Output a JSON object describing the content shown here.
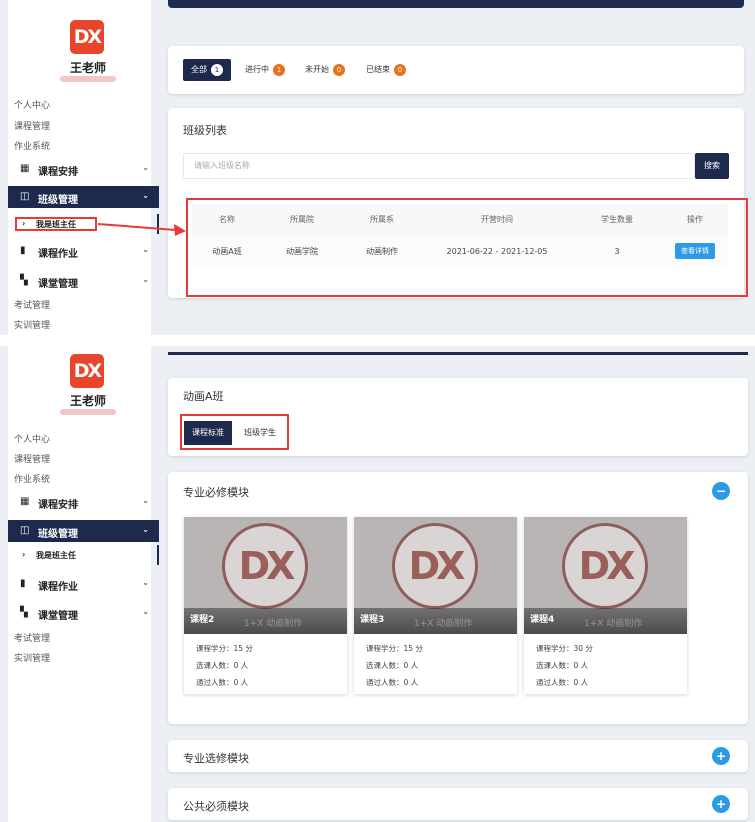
{
  "teacher_name": "王老师",
  "logo_text": "DX",
  "sidebar": {
    "plain_top": [
      "个人中心",
      "课程管理",
      "作业系统"
    ],
    "menus": [
      {
        "label": "课程安排",
        "icon": "calendar-icon",
        "glyph": "▦"
      },
      {
        "label": "班级管理",
        "icon": "class-icon",
        "glyph": "◫"
      },
      {
        "label": "课程作业",
        "icon": "homework-icon",
        "glyph": "▮"
      },
      {
        "label": "课堂管理",
        "icon": "book-icon",
        "glyph": "▚"
      }
    ],
    "submenu": "我是班主任",
    "plain_bottom": [
      "考试管理",
      "实训管理"
    ],
    "chevron": "⌄",
    "arrow": "›"
  },
  "filter_tabs": [
    {
      "label": "全部",
      "count": "1"
    },
    {
      "label": "进行中",
      "count": "1"
    },
    {
      "label": "未开始",
      "count": "0"
    },
    {
      "label": "已结束",
      "count": "0"
    }
  ],
  "class_list": {
    "title": "班级列表",
    "search_placeholder": "请输入班级名称",
    "search_button": "搜索",
    "columns": [
      "名称",
      "所属院",
      "所属系",
      "开营时间",
      "学生数量",
      "操作"
    ],
    "rows": [
      {
        "name": "动画A班",
        "college": "动画学院",
        "department": "动画制作",
        "period": "2021-06-22 - 2021-12-05",
        "students": "3",
        "action": "查看详情"
      }
    ]
  },
  "class_detail": {
    "title": "动画A班",
    "tabs": [
      "课程标准",
      "班级学生"
    ],
    "modules": [
      {
        "title": "专业必修模块",
        "toggle": "−"
      },
      {
        "title": "专业选修模块",
        "toggle": "+"
      },
      {
        "title": "公共必须模块",
        "toggle": "+"
      }
    ],
    "watermark": "1+X 动画制作",
    "courses": [
      {
        "name": "课程2",
        "credits": "课程学分：15 分",
        "enrolled": "选课人数：0 人",
        "passed": "通过人数：0 人"
      },
      {
        "name": "课程3",
        "credits": "课程学分：15 分",
        "enrolled": "选课人数：0 人",
        "passed": "通过人数：0 人"
      },
      {
        "name": "课程4",
        "credits": "课程学分：30 分",
        "enrolled": "选课人数：0 人",
        "passed": "通过人数：0 人"
      }
    ]
  },
  "colors": {
    "navy": "#1d2a4d",
    "accent_red": "#e8452c",
    "highlight": "#e83a3a",
    "blue": "#2d9ae6",
    "badge": "#e8721c"
  }
}
